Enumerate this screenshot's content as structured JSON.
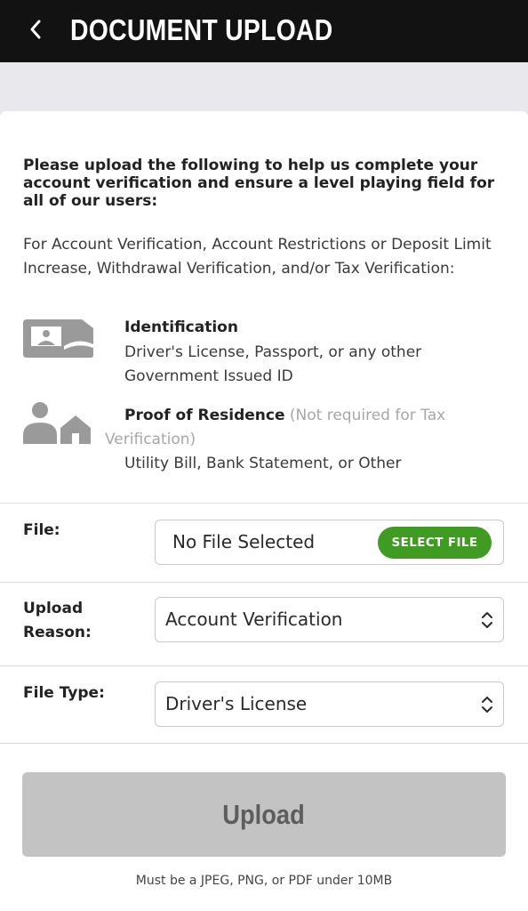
{
  "header": {
    "title": "DOCUMENT UPLOAD",
    "back_icon": "chevron-left-icon"
  },
  "intro": {
    "heading": "Please upload the following to help us complete your account verification and ensure a level playing field for all of our users:",
    "description": "For Account Verification, Account Restrictions or Deposit Limit Increase, Withdrawal Verification, and/or Tax Verification:"
  },
  "requirements": [
    {
      "icon": "id-card-icon",
      "title": "Identification",
      "description": "Driver's License, Passport, or any other Government Issued ID"
    },
    {
      "icon": "person-house-icon",
      "title": "Proof of Residence",
      "note": "(Not required for Tax Verification)",
      "description": "Utility Bill, Bank Statement, or Other"
    }
  ],
  "form": {
    "file": {
      "label": "File:",
      "value": "No File Selected",
      "button_label": "SELECT FILE"
    },
    "upload_reason": {
      "label": "Upload Reason:",
      "selected": "Account Verification"
    },
    "file_type": {
      "label": "File Type:",
      "selected": "Driver's License"
    }
  },
  "upload": {
    "button_label": "Upload",
    "footnote": "Must be a JPEG, PNG, or PDF under 10MB"
  },
  "colors": {
    "header_bg": "#121212",
    "accent_green": "#3f9b22",
    "disabled_button": "#c3c3c3",
    "icon_gray": "#9a9a9a"
  }
}
